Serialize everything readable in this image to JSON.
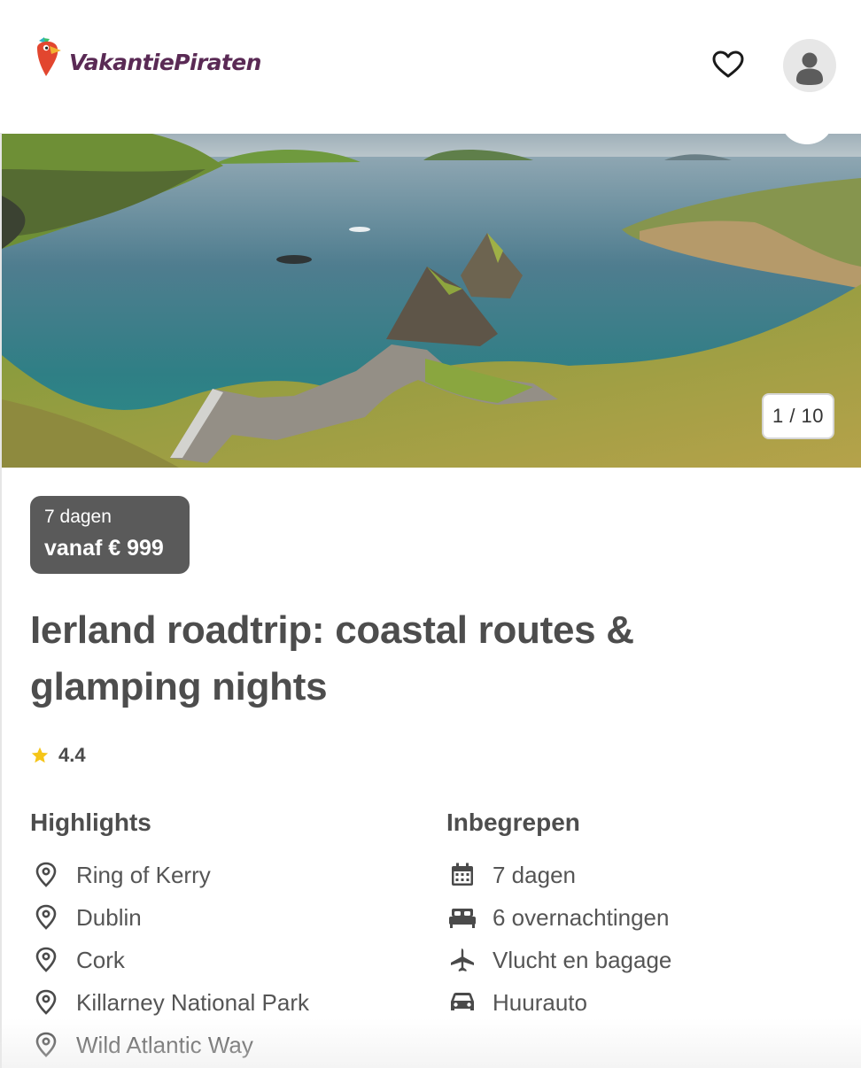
{
  "brand": {
    "name": "VakantiePiraten"
  },
  "gallery": {
    "counter": "1 / 10"
  },
  "price_badge": {
    "duration": "7 dagen",
    "price": "vanaf € 999"
  },
  "trip": {
    "title": "Ierland roadtrip: coastal routes & glamping nights",
    "rating": "4.4"
  },
  "highlights": {
    "title": "Highlights",
    "items": [
      {
        "label": "Ring of Kerry",
        "icon": "map-pin-icon"
      },
      {
        "label": "Dublin",
        "icon": "map-pin-icon"
      },
      {
        "label": "Cork",
        "icon": "map-pin-icon"
      },
      {
        "label": "Killarney National Park",
        "icon": "map-pin-icon"
      },
      {
        "label": "Wild Atlantic Way",
        "icon": "map-pin-icon"
      }
    ]
  },
  "included": {
    "title": "Inbegrepen",
    "items": [
      {
        "label": "7 dagen",
        "icon": "calendar-icon"
      },
      {
        "label": "6 overnachtingen",
        "icon": "bed-icon"
      },
      {
        "label": "Vlucht en bagage",
        "icon": "airplane-icon"
      },
      {
        "label": "Huurauto",
        "icon": "car-icon"
      }
    ]
  },
  "colors": {
    "brand_purple": "#5a2a55",
    "badge_bg": "#5a5a5a",
    "star": "#f5c518",
    "text": "#4a4a4a"
  }
}
